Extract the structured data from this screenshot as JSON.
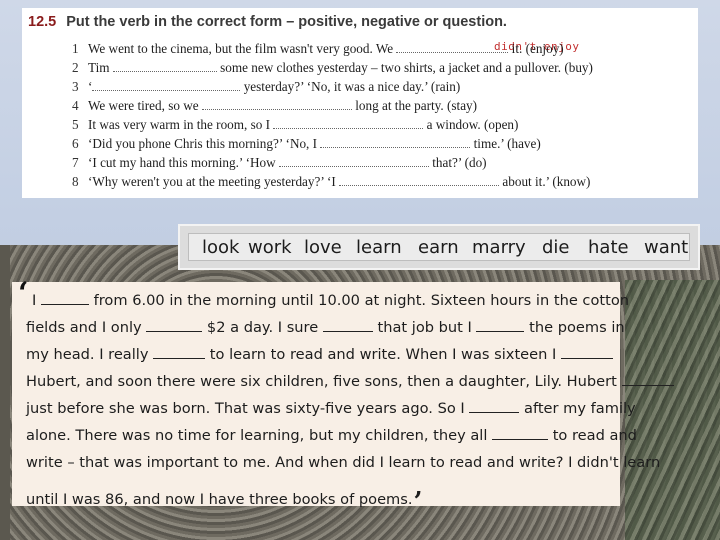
{
  "exercise": {
    "number": "12.5",
    "instruction": "Put the verb in the correct form – positive, negative or question.",
    "handwritten_answer": "didn't enjoy",
    "items": [
      {
        "n": "1",
        "parts": [
          "We went to the cinema, but the film wasn't very good.  We ",
          " it.  (enjoy)"
        ]
      },
      {
        "n": "2",
        "parts": [
          "Tim ",
          " some new clothes yesterday – two shirts, a jacket and a pullover.  (buy)"
        ]
      },
      {
        "n": "3",
        "parts": [
          "‘",
          " yesterday?’     ‘No, it was a nice day.’  (rain)"
        ]
      },
      {
        "n": "4",
        "parts": [
          "We were tired, so we ",
          " long at the party.  (stay)"
        ]
      },
      {
        "n": "5",
        "parts": [
          "It was very warm in the room, so I ",
          " a window.  (open)"
        ]
      },
      {
        "n": "6",
        "parts": [
          "‘Did you phone Chris this morning?’     ‘No, I ",
          " time.’  (have)"
        ]
      },
      {
        "n": "7",
        "parts": [
          "‘I cut my hand this morning.’     ‘How ",
          " that?’  (do)"
        ]
      },
      {
        "n": "8",
        "parts": [
          "‘Why weren't you at the meeting yesterday?’     ‘I ",
          " about it.’  (know)"
        ]
      }
    ]
  },
  "word_box": [
    "look",
    "work",
    "love",
    "learn",
    "earn",
    "marry",
    "die",
    "hate",
    "want"
  ],
  "story": {
    "quote_open": "‘",
    "quote_close": "’",
    "lines": [
      [
        "I ",
        " from 6.00 in the morning until 10.00 at night. Sixteen hours in the cotton"
      ],
      [
        "fields and I only ",
        " $2 a day. I sure ",
        " that job but I ",
        " the poems in"
      ],
      [
        "my head. I really ",
        " to learn to read and write. When I was sixteen I ",
        ""
      ],
      [
        "Hubert, and soon there were six children, five sons, then a daughter, Lily. Hubert ",
        ""
      ],
      [
        "just before she was born. That was sixty-five years ago. So I ",
        " after my family"
      ],
      [
        "alone. There was no time for learning, but my children, they all ",
        " to read and"
      ],
      [
        "write – that was important to me. And when did I learn to read and write? I didn't learn"
      ],
      [
        "until I was 86, and now I have three books of poems."
      ]
    ]
  }
}
